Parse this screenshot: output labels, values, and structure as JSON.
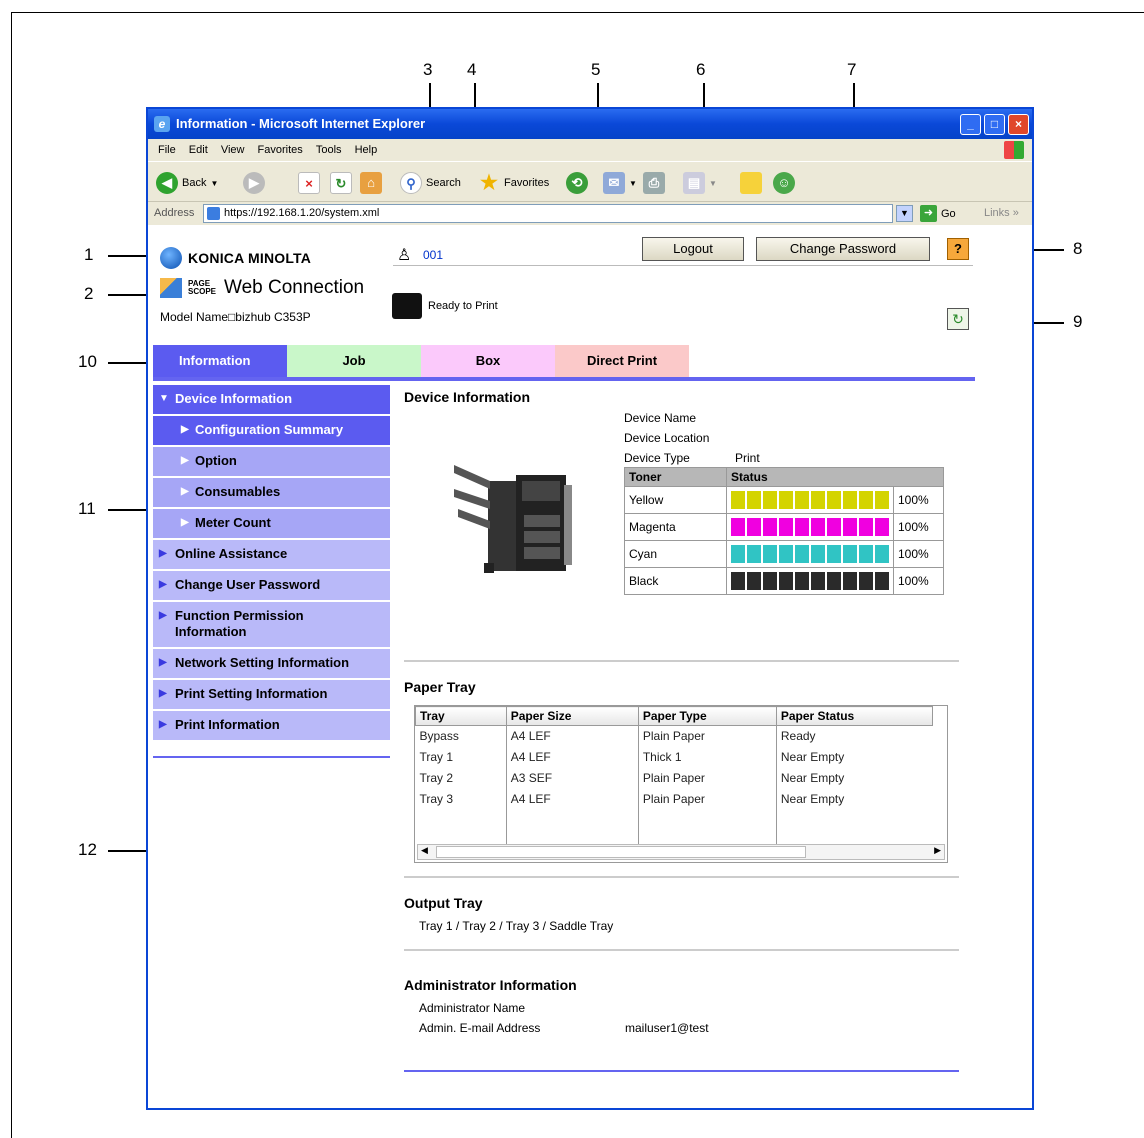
{
  "window": {
    "title": "Information - Microsoft Internet Explorer",
    "menu": [
      "File",
      "Edit",
      "View",
      "Favorites",
      "Tools",
      "Help"
    ],
    "toolbar": {
      "back": "Back",
      "search": "Search",
      "favorites": "Favorites"
    },
    "address_label": "Address",
    "address_url": "https://192.168.1.20/system.xml",
    "go_label": "Go",
    "links_label": "Links"
  },
  "callouts": [
    "1",
    "2",
    "3",
    "4",
    "5",
    "6",
    "7",
    "8",
    "9",
    "10",
    "11",
    "12"
  ],
  "header": {
    "brand": "KONICA MINOLTA",
    "pagescope_small": "PAGE SCOPE",
    "pagescope_product": "Web Connection",
    "model_name": "Model Name□bizhub C353P",
    "user_number": "001",
    "logout_label": "Logout",
    "change_password_label": "Change Password",
    "help_label": "?",
    "status_text": "Ready to Print"
  },
  "tabs": [
    "Information",
    "Job",
    "Box",
    "Direct Print"
  ],
  "sidebar": {
    "items": [
      {
        "label": "Device Information"
      },
      {
        "label": "Configuration Summary"
      },
      {
        "label": "Option"
      },
      {
        "label": "Consumables"
      },
      {
        "label": "Meter Count"
      },
      {
        "label": "Online Assistance"
      },
      {
        "label": "Change User Password"
      },
      {
        "label": "Function Permission Information"
      },
      {
        "label": "Network Setting Information"
      },
      {
        "label": "Print Setting Information"
      },
      {
        "label": "Print Information"
      }
    ]
  },
  "device_info": {
    "heading": "Device Information",
    "device_name_label": "Device Name",
    "device_location_label": "Device Location",
    "device_type_label": "Device Type",
    "device_type_value": "Print",
    "toner_header": "Toner",
    "status_header": "Status",
    "toners": [
      {
        "name": "Yellow",
        "level": "100%",
        "color": "#d4d400",
        "level_fraction": 1.0
      },
      {
        "name": "Magenta",
        "level": "100%",
        "color": "#f000e0",
        "level_fraction": 1.0
      },
      {
        "name": "Cyan",
        "level": "100%",
        "color": "#30c4c4",
        "level_fraction": 1.0
      },
      {
        "name": "Black",
        "level": "100%",
        "color": "#2a2a2a",
        "level_fraction": 1.0
      }
    ]
  },
  "paper_tray": {
    "heading": "Paper Tray",
    "columns": [
      "Tray",
      "Paper Size",
      "Paper Type",
      "Paper Status"
    ],
    "rows": [
      [
        "Bypass",
        "A4 LEF",
        "Plain Paper",
        "Ready"
      ],
      [
        "Tray 1",
        "A4 LEF",
        "Thick 1",
        "Near Empty"
      ],
      [
        "Tray 2",
        "A3 SEF",
        "Plain Paper",
        "Near Empty"
      ],
      [
        "Tray 3",
        "A4 LEF",
        "Plain Paper",
        "Near Empty"
      ]
    ]
  },
  "output_tray": {
    "heading": "Output Tray",
    "value": "Tray 1 / Tray 2 / Tray 3 / Saddle Tray"
  },
  "admin_info": {
    "heading": "Administrator Information",
    "name_label": "Administrator Name",
    "email_label": "Admin. E-mail Address",
    "email_value": "mailuser1@test"
  },
  "colors": {
    "accent": "#5b5bf0",
    "sidebar": "#b9b9f9",
    "tab_job": "#c9f7c9",
    "tab_box": "#fbc9fb",
    "tab_direct": "#fbc9c9"
  }
}
